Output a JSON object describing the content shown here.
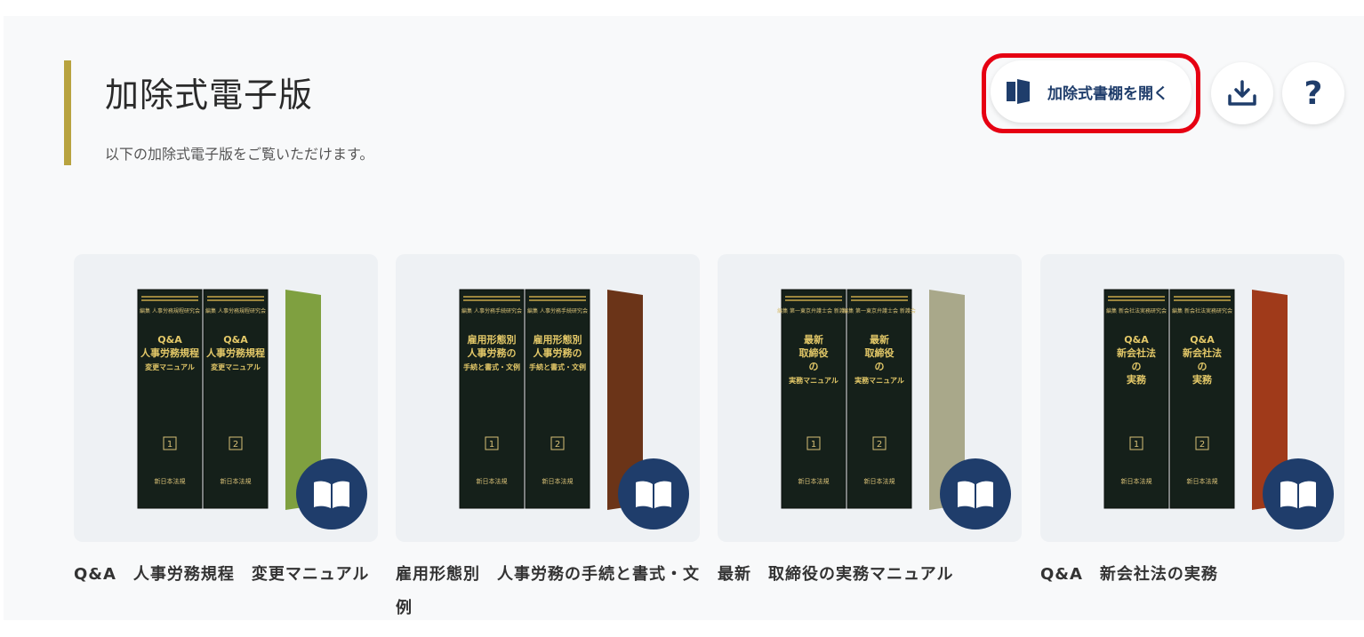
{
  "header": {
    "title": "加除式電子版",
    "subtitle": "以下の加除式電子版をご覧いただけます。",
    "open_shelf_label": "加除式書棚を開く",
    "help_label": "?"
  },
  "colors": {
    "accent": "#b8a33f",
    "primary": "#1f3d6b",
    "highlight": "#e60012"
  },
  "books": [
    {
      "title": "Q&A　人事労務規程　変更マニュアル",
      "spine_editor": "編集 人事労務規程研究会",
      "spine_lines": [
        "Q&A",
        "人事労務規程",
        "変更マニュアル"
      ],
      "volumes": [
        "1",
        "2"
      ],
      "publisher": "新日本法規",
      "side_color": "#7fa040"
    },
    {
      "title": "雇用形態別　人事労務の手続と書式・文例",
      "spine_editor": "編集 人事労務手続研究会",
      "spine_lines": [
        "雇用形態別",
        "人事労務の",
        "手続と書式・文例"
      ],
      "volumes": [
        "1",
        "2"
      ],
      "publisher": "新日本法規",
      "side_color": "#6b3418"
    },
    {
      "title": "最新　取締役の実務マニュアル",
      "spine_editor": "編集 第一東京弁護士会 新護会",
      "spine_lines": [
        "最新",
        "取締役",
        "の",
        "実務マニュアル"
      ],
      "volumes": [
        "1",
        "2"
      ],
      "publisher": "新日本法規",
      "side_color": "#a9a88a"
    },
    {
      "title": "Q&A　新会社法の実務",
      "spine_editor": "編集 新会社法実務研究会",
      "spine_lines": [
        "Q&A",
        "新会社法",
        "の",
        "実務"
      ],
      "volumes": [
        "1",
        "2"
      ],
      "publisher": "新日本法規",
      "side_color": "#a03a1a"
    }
  ]
}
